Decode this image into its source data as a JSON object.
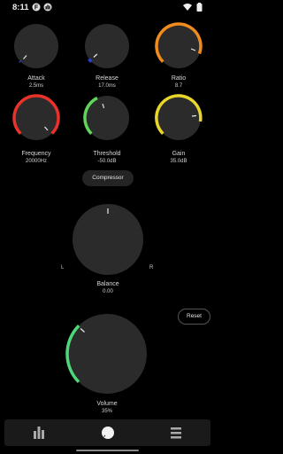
{
  "status_bar": {
    "time": "8:11"
  },
  "knobs": {
    "attack": {
      "label": "Attack",
      "value": "2.5ms"
    },
    "release": {
      "label": "Release",
      "value": "17.0ms"
    },
    "ratio": {
      "label": "Ratio",
      "value": "8.7"
    },
    "frequency": {
      "label": "Frequency",
      "value": "20000Hz"
    },
    "threshold": {
      "label": "Threshold",
      "value": "-50.0dB"
    },
    "gain": {
      "label": "Gain",
      "value": "35.0dB"
    },
    "balance": {
      "label": "Balance",
      "value": "0.00",
      "left_label": "L",
      "right_label": "R"
    },
    "volume": {
      "label": "Volume",
      "value": "35%"
    }
  },
  "compressor_button": {
    "label": "Compressor"
  },
  "reset_button": {
    "label": "Reset"
  },
  "colors": {
    "background": "#000000",
    "knob_face": "#2b2b2b",
    "attack_arc": "#2a3fd6",
    "ratio_arc": "#f08c1e",
    "frequency_arc": "#e8322a",
    "threshold_arc": "#5fd65a",
    "gain_arc": "#e8d62a",
    "volume_arc": "#4ed67a"
  },
  "nav": {
    "items": [
      {
        "icon": "equalizer-bars-icon"
      },
      {
        "icon": "knob-icon"
      },
      {
        "icon": "menu-lines-icon"
      }
    ]
  }
}
